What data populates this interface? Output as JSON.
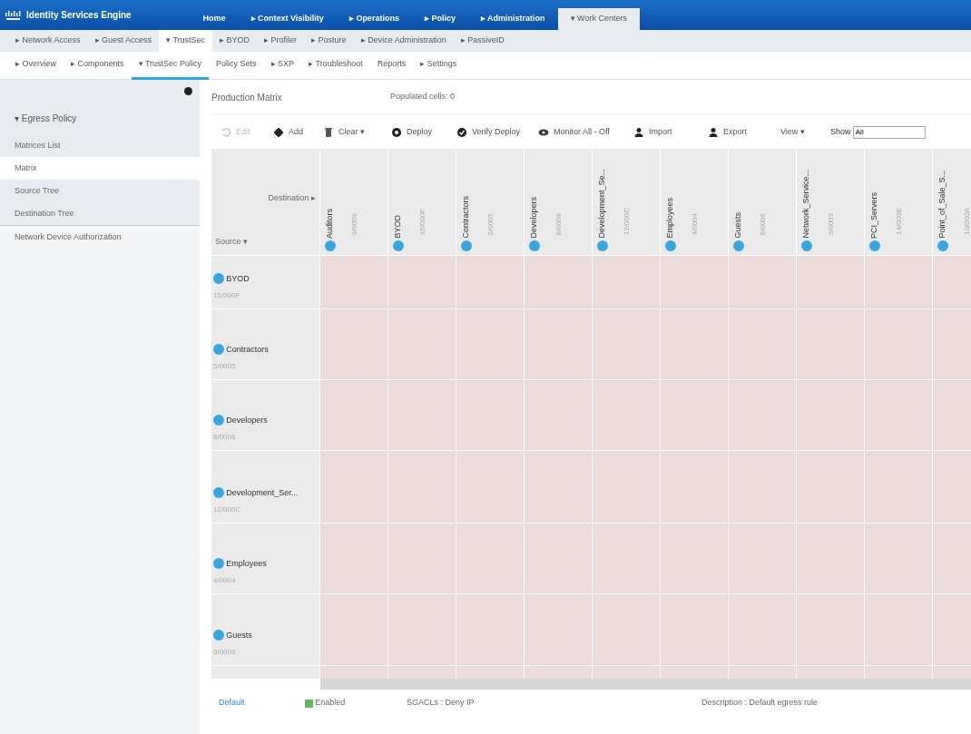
{
  "app_title": "Identity Services Engine",
  "main_tabs": [
    {
      "label": "Home",
      "selected": false
    },
    {
      "label": "▸ Context Visibility",
      "selected": false
    },
    {
      "label": "▸ Operations",
      "selected": false
    },
    {
      "label": "▸ Policy",
      "selected": false
    },
    {
      "label": "▸ Administration",
      "selected": false
    },
    {
      "label": "▾ Work Centers",
      "selected": true
    }
  ],
  "sub_tabs": [
    {
      "label": "▸ Network Access",
      "selected": false
    },
    {
      "label": "▸ Guest Access",
      "selected": false
    },
    {
      "label": "▾ TrustSec",
      "selected": true
    },
    {
      "label": "▸ BYOD",
      "selected": false
    },
    {
      "label": "▸ Profiler",
      "selected": false
    },
    {
      "label": "▸ Posture",
      "selected": false
    },
    {
      "label": "▸ Device Administration",
      "selected": false
    },
    {
      "label": "▸ PassiveID",
      "selected": false
    }
  ],
  "section_tabs": [
    {
      "label": "▸ Overview",
      "selected": false
    },
    {
      "label": "▸ Components",
      "selected": false
    },
    {
      "label": "▾ TrustSec Policy",
      "selected": true
    },
    {
      "label": "Policy Sets",
      "selected": false
    },
    {
      "label": "▸ SXP",
      "selected": false
    },
    {
      "label": "▸ Troubleshoot",
      "selected": false
    },
    {
      "label": "Reports",
      "selected": false
    },
    {
      "label": "▸ Settings",
      "selected": false
    }
  ],
  "sidebar": {
    "items": [
      {
        "label": "▾ Egress Policy",
        "selected": false,
        "children": [
          {
            "label": "Matrices List",
            "selected": false
          },
          {
            "label": "Matrix",
            "selected": true
          },
          {
            "label": "Source Tree",
            "selected": false
          },
          {
            "label": "Destination Tree",
            "selected": false
          }
        ]
      },
      {
        "label": "Network Device Authorization",
        "selected": false
      }
    ]
  },
  "matrix_title": "Production Matrix",
  "populated_cells": "Populated cells: 0",
  "toolbar": [
    {
      "kind": "edit",
      "label": "Edit",
      "disabled": true
    },
    {
      "kind": "add",
      "label": "Add",
      "disabled": false
    },
    {
      "kind": "clear",
      "label": "Clear ▾",
      "disabled": false
    },
    {
      "kind": "deploy",
      "label": "Deploy",
      "disabled": false
    },
    {
      "kind": "verify",
      "label": "Verify Deploy",
      "disabled": false
    },
    {
      "kind": "monitor",
      "label": "Monitor All - Off",
      "disabled": false
    },
    {
      "kind": "import",
      "label": "Import",
      "disabled": false
    },
    {
      "kind": "export",
      "label": "Export",
      "disabled": false
    },
    {
      "kind": "view",
      "label": "View ▾",
      "disabled": false
    }
  ],
  "show": {
    "label": "Show",
    "value": "All"
  },
  "matrix": {
    "destination_label": "Destination ▸",
    "source_label": "Source ▾",
    "columns": [
      {
        "name": "Auditors",
        "tag": "9/0009"
      },
      {
        "name": "BYOD",
        "tag": "15/000F"
      },
      {
        "name": "Contractors",
        "tag": "5/0005"
      },
      {
        "name": "Developers",
        "tag": "8/0008"
      },
      {
        "name": "Development_Se...",
        "tag": "12/000C"
      },
      {
        "name": "Employees",
        "tag": "4/0004"
      },
      {
        "name": "Guests",
        "tag": "6/0006"
      },
      {
        "name": "Network_Service...",
        "tag": "3/0003"
      },
      {
        "name": "PCI_Servers",
        "tag": "14/000E"
      },
      {
        "name": "Point_of_Sale_S...",
        "tag": "10/000A"
      }
    ],
    "rows": [
      {
        "name": "BYOD",
        "tag": "15/000F"
      },
      {
        "name": "Contractors",
        "tag": "5/0005"
      },
      {
        "name": "Developers",
        "tag": "8/0008"
      },
      {
        "name": "Development_Ser...",
        "tag": "12/000C"
      },
      {
        "name": "Employees",
        "tag": "4/0004"
      },
      {
        "name": "Guests",
        "tag": "6/0006"
      }
    ]
  },
  "footer": {
    "rule": "Default",
    "status": "Enabled",
    "enabled": true,
    "sgacls": "SGACLs : Deny IP",
    "description": "Description : Default egress rule"
  }
}
